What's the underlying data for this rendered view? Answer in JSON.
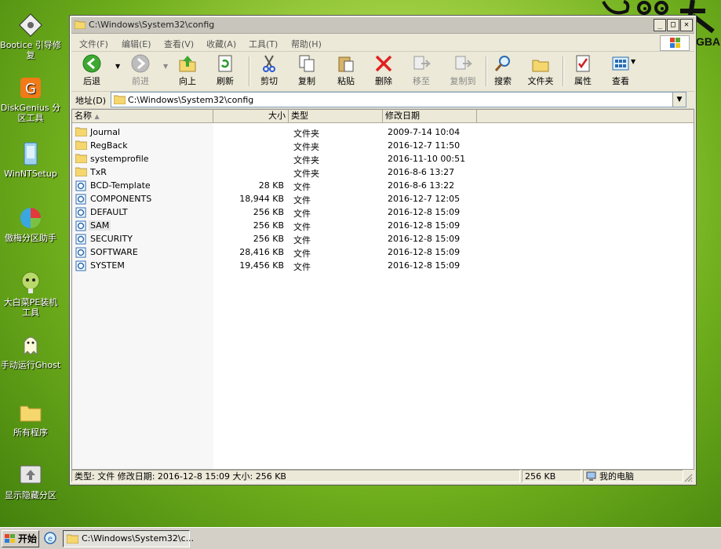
{
  "desktop": {
    "icons": [
      {
        "label": "Bootice 引导修复",
        "icon": "bootice-icon"
      },
      {
        "label": "DiskGenius 分区工具",
        "icon": "diskgenius-icon"
      },
      {
        "label": "WinNTSetup",
        "icon": "winntsetup-icon"
      },
      {
        "label": "傲梅分区助手",
        "icon": "partition-assistant-icon"
      },
      {
        "label": "大白菜PE装机工具",
        "icon": "cabbage-installer-icon"
      },
      {
        "label": "手动运行Ghost",
        "icon": "ghost-icon"
      },
      {
        "label": "所有程序",
        "icon": "folder-icon"
      },
      {
        "label": "显示隐藏分区",
        "icon": "hidden-partition-icon"
      }
    ],
    "brand_fragment": "GBA"
  },
  "window": {
    "title": "C:\\Windows\\System32\\config",
    "menu": [
      "文件(F)",
      "编辑(E)",
      "查看(V)",
      "收藏(A)",
      "工具(T)",
      "帮助(H)"
    ],
    "toolbar": {
      "back": "后退",
      "forward": "前进",
      "up": "向上",
      "refresh": "刷新",
      "cut": "剪切",
      "copy": "复制",
      "paste": "粘贴",
      "delete": "删除",
      "move_to": "移至",
      "copy_to": "复制到",
      "search": "搜索",
      "folders": "文件夹",
      "properties": "属性",
      "views": "查看"
    },
    "address": {
      "label": "地址(D)",
      "value": "C:\\Windows\\System32\\config"
    },
    "columns": {
      "name": "名称",
      "size": "大小",
      "type": "类型",
      "modified": "修改日期"
    },
    "files": [
      {
        "name": "Journal",
        "size": "",
        "type": "文件夹",
        "date": "2009-7-14 10:04",
        "kind": "folder"
      },
      {
        "name": "RegBack",
        "size": "",
        "type": "文件夹",
        "date": "2016-12-7 11:50",
        "kind": "folder"
      },
      {
        "name": "systemprofile",
        "size": "",
        "type": "文件夹",
        "date": "2016-11-10 00:51",
        "kind": "folder"
      },
      {
        "name": "TxR",
        "size": "",
        "type": "文件夹",
        "date": "2016-8-6 13:27",
        "kind": "folder"
      },
      {
        "name": "BCD-Template",
        "size": "28 KB",
        "type": "文件",
        "date": "2016-8-6 13:22",
        "kind": "file"
      },
      {
        "name": "COMPONENTS",
        "size": "18,944 KB",
        "type": "文件",
        "date": "2016-12-7 12:05",
        "kind": "file"
      },
      {
        "name": "DEFAULT",
        "size": "256 KB",
        "type": "文件",
        "date": "2016-12-8 15:09",
        "kind": "file"
      },
      {
        "name": "SAM",
        "size": "256 KB",
        "type": "文件",
        "date": "2016-12-8 15:09",
        "kind": "file"
      },
      {
        "name": "SECURITY",
        "size": "256 KB",
        "type": "文件",
        "date": "2016-12-8 15:09",
        "kind": "file"
      },
      {
        "name": "SOFTWARE",
        "size": "28,416 KB",
        "type": "文件",
        "date": "2016-12-8 15:09",
        "kind": "file"
      },
      {
        "name": "SYSTEM",
        "size": "19,456 KB",
        "type": "文件",
        "date": "2016-12-8 15:09",
        "kind": "file"
      }
    ],
    "selected_index": 7,
    "status": {
      "info": "类型: 文件 修改日期: 2016-12-8 15:09 大小: 256 KB",
      "size": "256 KB",
      "location": "我的电脑"
    }
  },
  "taskbar": {
    "start_label": "开始",
    "task_label": "C:\\Windows\\System32\\c..."
  }
}
